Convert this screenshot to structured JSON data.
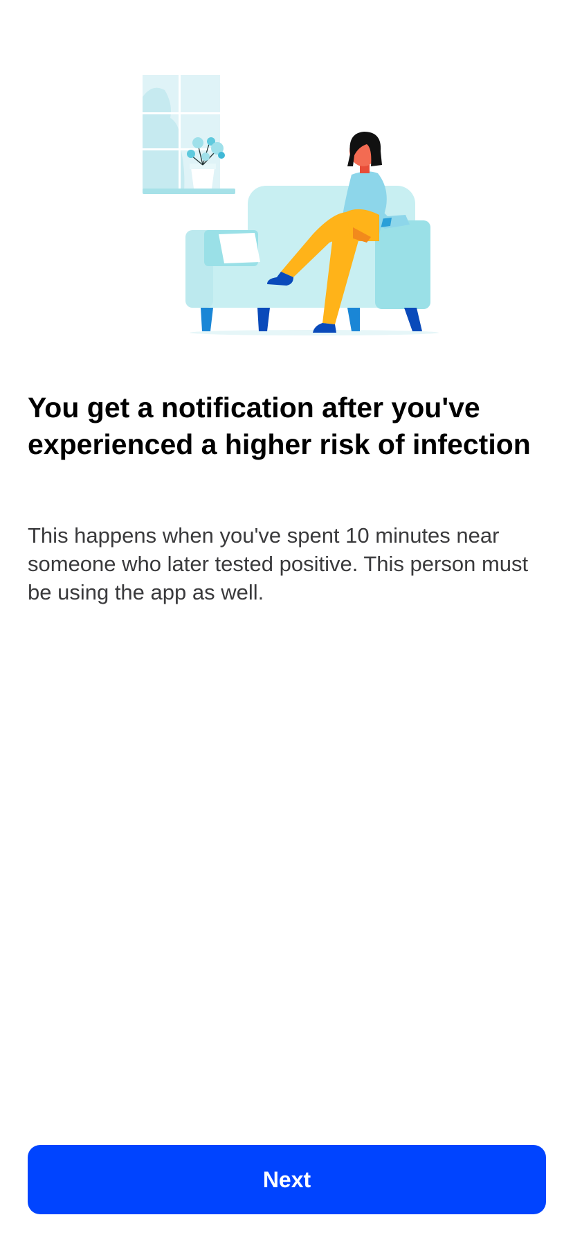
{
  "onboarding": {
    "illustration": "person-on-sofa-illustration",
    "title": "You get a notification after you've experienced a higher risk of infection",
    "body": "This happens when you've spent 10 minutes near someone who later tested positive. This person must be using the app as well.",
    "next_label": "Next"
  },
  "colors": {
    "accent": "#0044ff",
    "title": "#000000",
    "body": "#3a3a3c",
    "background": "#ffffff"
  }
}
